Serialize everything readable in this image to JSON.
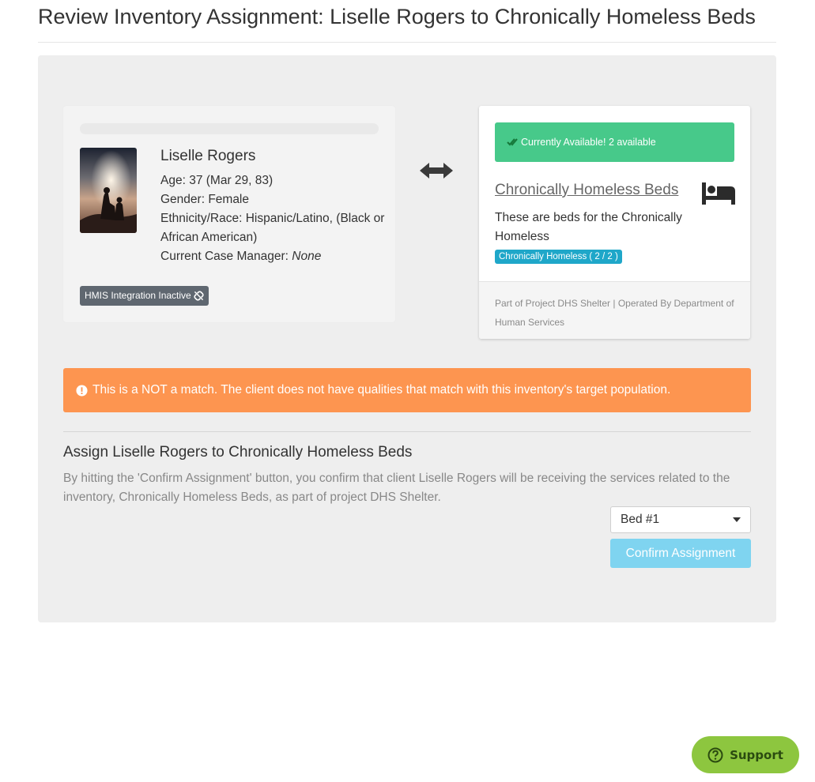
{
  "page": {
    "title": "Review Inventory Assignment: Liselle Rogers to Chronically Homeless Beds"
  },
  "client": {
    "name": "Liselle Rogers",
    "age_label": "Age: ",
    "age_value": "37 (Mar 29, 83)",
    "gender_label": "Gender: ",
    "gender_value": "Female",
    "ethnicity_label": "Ethnicity/Race: ",
    "ethnicity_value": "Hispanic/Latino, (Black or African American)",
    "case_manager_label": "Current Case Manager: ",
    "case_manager_value": "None",
    "hmis_badge": "HMIS Integration Inactive",
    "hmis_icon": "unlink-icon"
  },
  "inventory": {
    "availability": "Currently Available! 2 available",
    "availability_icon": "double-check-icon",
    "name": "Chronically Homeless Beds",
    "icon": "bed-icon",
    "description": "These are beds for the Chronically Homeless",
    "population_badge": "Chronically Homeless ( 2 / 2 )",
    "footer": "Part of Project DHS Shelter | Operated By Department of Human Services"
  },
  "warning": {
    "icon": "exclamation-circle-icon",
    "text": "This is a NOT a match. The client does not have qualities that match with this inventory's target population."
  },
  "assign": {
    "heading": "Assign Liselle Rogers to Chronically Homeless Beds",
    "description": "By hitting the 'Confirm Assignment' button, you confirm that client Liselle Rogers will be receiving the services related to the inventory, Chronically Homeless Beds, as part of project DHS Shelter.",
    "bed_select_value": "Bed #1",
    "confirm_label": "Confirm Assignment"
  },
  "support": {
    "label": "Support",
    "icon": "question-circle-icon"
  },
  "colors": {
    "available_green": "#47c98a",
    "warning_orange": "#fd9550",
    "badge_teal": "#1fa7c9",
    "confirm_blue": "#7fd4f0",
    "support_green": "#8dc63f",
    "hmis_badge_gray": "#5f6770"
  }
}
